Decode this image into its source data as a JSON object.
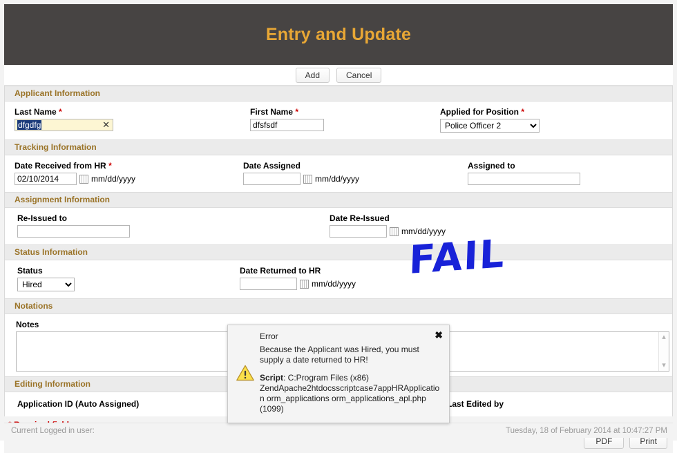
{
  "header": {
    "title": "Entry and Update"
  },
  "toolbar": {
    "add_label": "Add",
    "cancel_label": "Cancel"
  },
  "sections": {
    "applicant": {
      "heading": "Applicant Information",
      "last_name_label": "Last Name",
      "last_name_value": "dfgdfg",
      "last_name_clear": "✕",
      "first_name_label": "First Name",
      "first_name_value": "dfsfsdf",
      "position_label": "Applied for Position",
      "position_value": "Police Officer 2"
    },
    "tracking": {
      "heading": "Tracking Information",
      "date_received_label": "Date Received from HR",
      "date_received_value": "02/10/2014",
      "date_received_hint": "mm/dd/yyyy",
      "date_assigned_label": "Date Assigned",
      "date_assigned_value": "",
      "date_assigned_hint": "mm/dd/yyyy",
      "assigned_to_label": "Assigned to",
      "assigned_to_value": ""
    },
    "assignment": {
      "heading": "Assignment Information",
      "reissued_to_label": "Re-Issued to",
      "reissued_to_value": "",
      "date_reissued_label": "Date Re-Issued",
      "date_reissued_value": "",
      "date_reissued_hint": "mm/dd/yyyy"
    },
    "status": {
      "heading": "Status Information",
      "status_label": "Status",
      "status_value": "Hired",
      "date_returned_label": "Date Returned to HR",
      "date_returned_value": "",
      "date_returned_hint": "mm/dd/yyyy"
    },
    "notations": {
      "heading": "Notations",
      "notes_label": "Notes",
      "notes_value": ""
    },
    "editing": {
      "heading": "Editing Information",
      "application_id_label": "Application ID (Auto Assigned)",
      "last_edited_by_label": "Last Edited by"
    }
  },
  "required_note": "* Required field",
  "actions": {
    "pdf_label": "PDF",
    "print_label": "Print"
  },
  "footer": {
    "user_text": "Current Logged in user:",
    "timestamp": "Tuesday, 18 of February 2014 at 10:47:27 PM"
  },
  "annotation": {
    "fail_text": "FAIL"
  },
  "error_dialog": {
    "title": "Error",
    "message": "Because the Applicant was Hired, you must supply a date returned to HR!",
    "script_label": "Script",
    "script_path": ": C:Program Files (x86) ZendApache2htdocsscriptcase7appHRApplication orm_applications orm_applications_apl.php (1099)",
    "close_label": "✖"
  },
  "colors": {
    "banner_bg": "#474443",
    "banner_title": "#e8a735",
    "section_heading": "#9a7327",
    "required": "#cc0000",
    "annotation": "#1822d8",
    "autofill_bg": "#fdf6d3",
    "selection_bg": "#1a3a7a"
  }
}
